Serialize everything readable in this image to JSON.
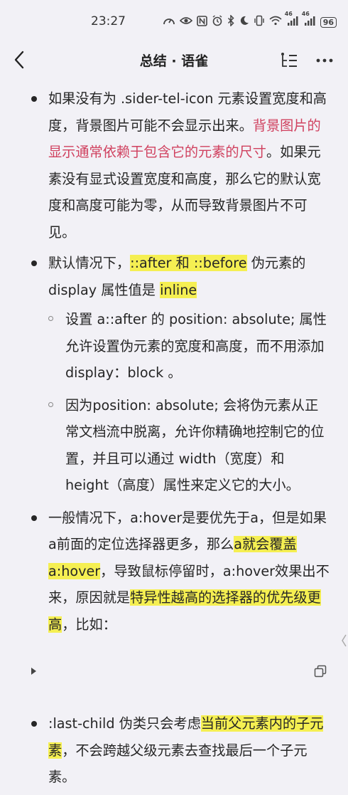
{
  "status": {
    "time": "23:27",
    "network1": "46",
    "network2": "46",
    "battery": "96"
  },
  "nav": {
    "title": "总结 · 语雀"
  },
  "content": {
    "item1": {
      "t1": "如果没有为 .sider-tel-icon 元素设置宽度和高度，背景图片可能不会显示出来。",
      "t2": "背景图片的显示通常依赖于包含它的元素的尺寸",
      "t3": "。如果元素没有显式设置宽度和高度，那么它的默认宽度和高度可能为零，从而导致背景图片不可见。"
    },
    "item2": {
      "t1": "默认情况下，",
      "h1": "::after 和 ::before",
      "t2": " 伪元素的 display 属性值是 ",
      "h2": "inline",
      "sub1": "设置 a::after 的 position: absolute; 属性允许设置伪元素的宽度和高度，而不用添加 display：block 。",
      "sub2": "因为position: absolute; 会将伪元素从正常文档流中脱离，允许你精确地控制它的位置，并且可以通过 width（宽度）和 height（高度）属性来定义它的大小。"
    },
    "item3": {
      "t1": "一般情况下，a:hover是要优先于a，但是如果a前面的定位选择器更多，那么",
      "h1": "a就会覆盖a:hover",
      "t2": "，导致鼠标停留时，a:hover效果出不来，原因就是",
      "h2": "特异性越高的选择器的优先级更高",
      "t3": "，比如："
    },
    "item4": {
      "t1": ":last-child 伪类只会考虑",
      "h1": "当前父元素内的子元素",
      "t2": "，不会跨越父级元素去查找最后一个子元素。"
    }
  }
}
